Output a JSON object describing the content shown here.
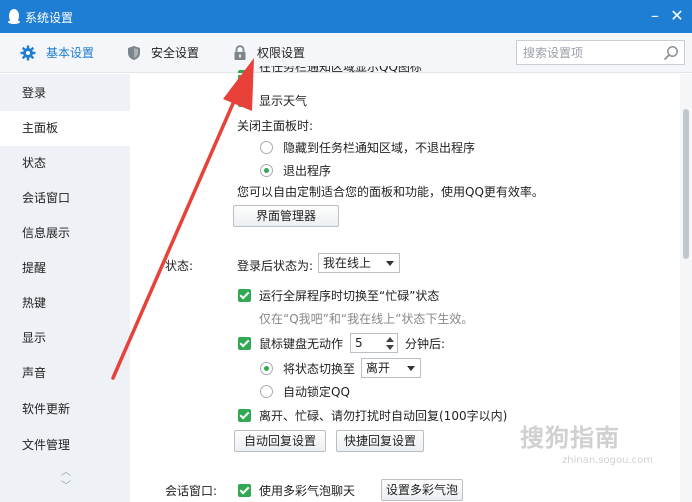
{
  "window": {
    "title": "系统设置",
    "minimize_glyph": "–",
    "close_glyph": "✕"
  },
  "toolbar": {
    "tabs": [
      {
        "label": "基本设置",
        "icon": "gear-icon",
        "active": true
      },
      {
        "label": "安全设置",
        "icon": "shield-icon",
        "active": false
      },
      {
        "label": "权限设置",
        "icon": "lock-icon",
        "active": false
      }
    ],
    "search": {
      "placeholder": "搜索设置项",
      "value": ""
    }
  },
  "sidebar": {
    "items": [
      {
        "label": "登录"
      },
      {
        "label": "主面板",
        "active": true
      },
      {
        "label": "状态"
      },
      {
        "label": "会话窗口"
      },
      {
        "label": "信息展示"
      },
      {
        "label": "提醒"
      },
      {
        "label": "热键"
      },
      {
        "label": "显示"
      },
      {
        "label": "声音"
      },
      {
        "label": "软件更新"
      },
      {
        "label": "文件管理"
      }
    ]
  },
  "main_panel": {
    "partial_option": "在任务栏通知区域显示QQ图标",
    "show_weather": "显示天气",
    "close_panel_label": "关闭主面板时:",
    "close_options": [
      {
        "label": "隐藏到任务栏通知区域，不退出程序",
        "selected": false
      },
      {
        "label": "退出程序",
        "selected": true
      }
    ],
    "customize_text": "您可以自由定制适合您的面板和功能，使用QQ更有效率。",
    "interface_manager_button": "界面管理器"
  },
  "status": {
    "section_label": "状态:",
    "after_login_label": "登录后状态为:",
    "after_login_value": "我在线上",
    "fullscreen_busy": "运行全屏程序时切换至“忙碌”状态",
    "fullscreen_hint": "仅在“Q我吧”和“我在线上”状态下生效。",
    "idle_label": "鼠标键盘无动作",
    "idle_minutes": "5",
    "idle_suffix": "分钟后:",
    "idle_options": [
      {
        "label": "将状态切换至",
        "selected": true,
        "value": "离开"
      },
      {
        "label": "自动锁定QQ",
        "selected": false
      }
    ],
    "auto_reply": "离开、忙碌、请勿打扰时自动回复(100字以内)",
    "auto_reply_button": "自动回复设置",
    "quick_reply_button": "快捷回复设置"
  },
  "chat_window": {
    "section_label": "会话窗口:",
    "bubble_option": "使用多彩气泡聊天",
    "bubble_button": "设置多彩气泡"
  },
  "watermark": {
    "text": "搜狗指南",
    "sub": "zhinan.sogou.com"
  },
  "colors": {
    "titlebar": "#1d7ed3",
    "accent": "#32a852",
    "arrow": "#e8413a"
  }
}
